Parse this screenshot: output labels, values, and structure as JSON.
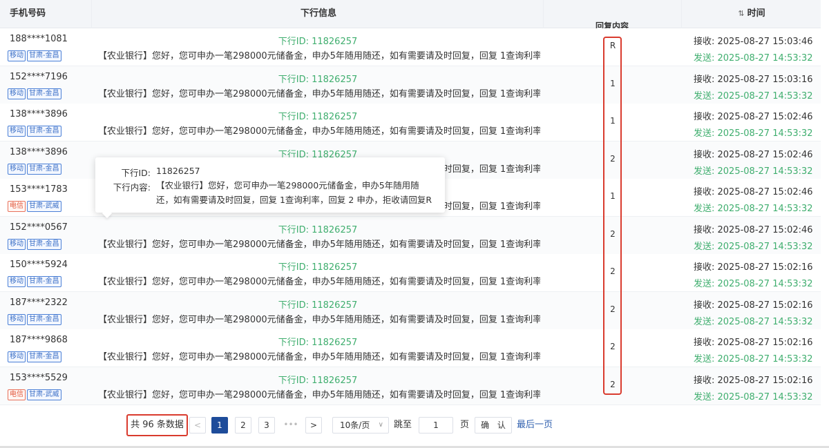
{
  "headers": {
    "phone": "手机号码",
    "message": "下行信息",
    "reply": "回复内容",
    "time": "时间",
    "time_sort_icon": "sort-icon"
  },
  "rows": [
    {
      "phone": "188****1081",
      "carrier": "移动",
      "region": "甘肃-金昌",
      "msg_id": "下行ID: 11826257",
      "msg": "【农业银行】您好，您可申办一笔298000元储备金，申办5年随用随还，如有需要请及时回复，回复 1查询利率…",
      "reply": "R",
      "recv": "接收: 2025-08-27 15:03:46",
      "send": "发送: 2025-08-27 14:53:32"
    },
    {
      "phone": "152****7196",
      "carrier": "移动",
      "region": "甘肃-金昌",
      "msg_id": "下行ID: 11826257",
      "msg": "【农业银行】您好，您可申办一笔298000元储备金，申办5年随用随还，如有需要请及时回复，回复 1查询利率…",
      "reply": "1",
      "recv": "接收: 2025-08-27 15:03:16",
      "send": "发送: 2025-08-27 14:53:32"
    },
    {
      "phone": "138****3896",
      "carrier": "移动",
      "region": "甘肃-金昌",
      "msg_id": "下行ID: 11826257",
      "msg": "【农业银行】您好，您可申办一笔298000元储备金，申办5年随用随还，如有需要请及时回复，回复 1查询利率…",
      "reply": "1",
      "recv": "接收: 2025-08-27 15:02:46",
      "send": "发送: 2025-08-27 14:53:32"
    },
    {
      "phone": "138****3896",
      "carrier": "移动",
      "region": "甘肃-金昌",
      "msg_id": "下行ID: 11826257",
      "msg": "【农业银行】您好，您可申办一笔298000元储备金，申办5年随用随还，如有需要请及时回复，回复 1查询利率…",
      "reply": "2",
      "recv": "接收: 2025-08-27 15:02:46",
      "send": "发送: 2025-08-27 14:53:32"
    },
    {
      "phone": "153****1783",
      "carrier": "电信",
      "region": "甘肃-武威",
      "msg_id": "下行ID: 11826257",
      "msg": "【农业银行】您好，您可申办一笔298000元储备金，申办5年随用随还，如有需要请及时回复，回复 1查询利率…",
      "reply": "1",
      "recv": "接收: 2025-08-27 15:02:46",
      "send": "发送: 2025-08-27 14:53:32"
    },
    {
      "phone": "152****0567",
      "carrier": "移动",
      "region": "甘肃-金昌",
      "msg_id": "下行ID: 11826257",
      "msg": "【农业银行】您好，您可申办一笔298000元储备金，申办5年随用随还，如有需要请及时回复，回复 1查询利率…",
      "reply": "2",
      "recv": "接收: 2025-08-27 15:02:46",
      "send": "发送: 2025-08-27 14:53:32"
    },
    {
      "phone": "150****5924",
      "carrier": "移动",
      "region": "甘肃-金昌",
      "msg_id": "下行ID: 11826257",
      "msg": "【农业银行】您好，您可申办一笔298000元储备金，申办5年随用随还，如有需要请及时回复，回复 1查询利率…",
      "reply": "2",
      "recv": "接收: 2025-08-27 15:02:16",
      "send": "发送: 2025-08-27 14:53:32"
    },
    {
      "phone": "187****2322",
      "carrier": "移动",
      "region": "甘肃-金昌",
      "msg_id": "下行ID: 11826257",
      "msg": "【农业银行】您好，您可申办一笔298000元储备金，申办5年随用随还，如有需要请及时回复，回复 1查询利率…",
      "reply": "2",
      "recv": "接收: 2025-08-27 15:02:16",
      "send": "发送: 2025-08-27 14:53:32"
    },
    {
      "phone": "187****9868",
      "carrier": "移动",
      "region": "甘肃-金昌",
      "msg_id": "下行ID: 11826257",
      "msg": "【农业银行】您好，您可申办一笔298000元储备金，申办5年随用随还，如有需要请及时回复，回复 1查询利率…",
      "reply": "2",
      "recv": "接收: 2025-08-27 15:02:16",
      "send": "发送: 2025-08-27 14:53:32"
    },
    {
      "phone": "153****5529",
      "carrier": "电信",
      "region": "甘肃-武威",
      "msg_id": "下行ID: 11826257",
      "msg": "【农业银行】您好，您可申办一笔298000元储备金，申办5年随用随还，如有需要请及时回复，回复 1查询利率…",
      "reply": "2",
      "recv": "接收: 2025-08-27 15:02:16",
      "send": "发送: 2025-08-27 14:53:32"
    }
  ],
  "tooltip": {
    "id_label": "下行ID:",
    "id_value": "11826257",
    "content_label": "下行内容:",
    "content_value": "【农业银行】您好，您可申办一笔298000元储备金，申办5年随用随还，如有需要请及时回复，回复 1查询利率，回复 2 申办，拒收请回复R"
  },
  "pagination": {
    "total": "共 96 条数据",
    "prev": "<",
    "next": ">",
    "pages": [
      "1",
      "2",
      "3"
    ],
    "ellipsis": "•••",
    "page_size": "10条/页",
    "jump_label": "跳至",
    "jump_value": "1",
    "page_suffix": "页",
    "confirm": "确 认",
    "last_page": "最后一页"
  },
  "colors": {
    "green": "#3fae6e",
    "red_highlight": "#d93a2d",
    "active_page": "#1e4c9a",
    "mobile_tag": "#3b6fc6",
    "telecom_tag": "#e25a3f"
  }
}
